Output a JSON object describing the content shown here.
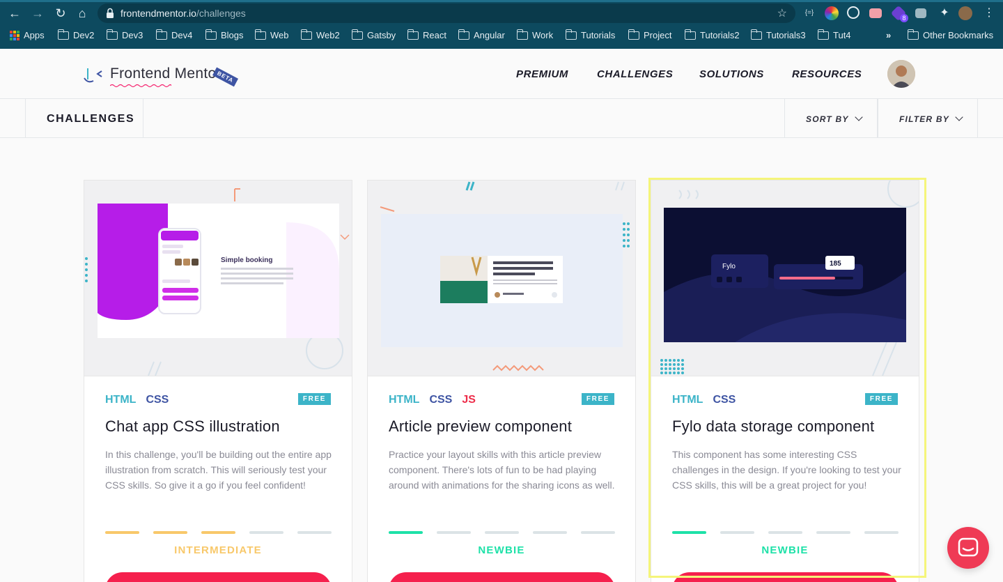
{
  "browser": {
    "url_host": "frontendmentor.io",
    "url_path": "/challenges",
    "bookmarks": [
      "Apps",
      "Dev2",
      "Dev3",
      "Dev4",
      "Blogs",
      "Web",
      "Web2",
      "Gatsby",
      "React",
      "Angular",
      "Work",
      "Tutorials",
      "Project",
      "Tutorials2",
      "Tutorials3",
      "Tut4"
    ],
    "overflow": "»",
    "other_bookmarks": "Other Bookmarks",
    "ext_badge": "8"
  },
  "header": {
    "logo_text": "Frontend Mentor",
    "beta": "BETA",
    "nav": [
      "PREMIUM",
      "CHALLENGES",
      "SOLUTIONS",
      "RESOURCES"
    ]
  },
  "filter_bar": {
    "title": "CHALLENGES",
    "sort": "SORT BY",
    "filter": "FILTER BY"
  },
  "cards": [
    {
      "tags": [
        "HTML",
        "CSS"
      ],
      "badge": "FREE",
      "title": "Chat app CSS illustration",
      "description": "In this challenge, you'll be building out the entire app illustration from scratch. This will seriously test your CSS skills. So give it a go if you feel confident!",
      "level": "INTERMEDIATE",
      "level_value": 3,
      "preview_heading": "Simple booking"
    },
    {
      "tags": [
        "HTML",
        "CSS",
        "JS"
      ],
      "badge": "FREE",
      "title": "Article preview component",
      "description": "Practice your layout skills with this article preview component. There's lots of fun to be had playing around with animations for the sharing icons as well.",
      "level": "NEWBIE",
      "level_value": 1
    },
    {
      "tags": [
        "HTML",
        "CSS"
      ],
      "badge": "FREE",
      "title": "Fylo data storage component",
      "description": "This component has some interesting CSS challenges in the design. If you're looking to test your CSS skills, this will be a great project for you!",
      "level": "NEWBIE",
      "level_value": 1,
      "preview_logo": "Fylo",
      "preview_stat": "185"
    }
  ],
  "colors": {
    "intermediate": "#f8c86a",
    "newbie": "#1ee1a8",
    "inactive": "#dbe3e6",
    "cta": "#f5204d"
  }
}
